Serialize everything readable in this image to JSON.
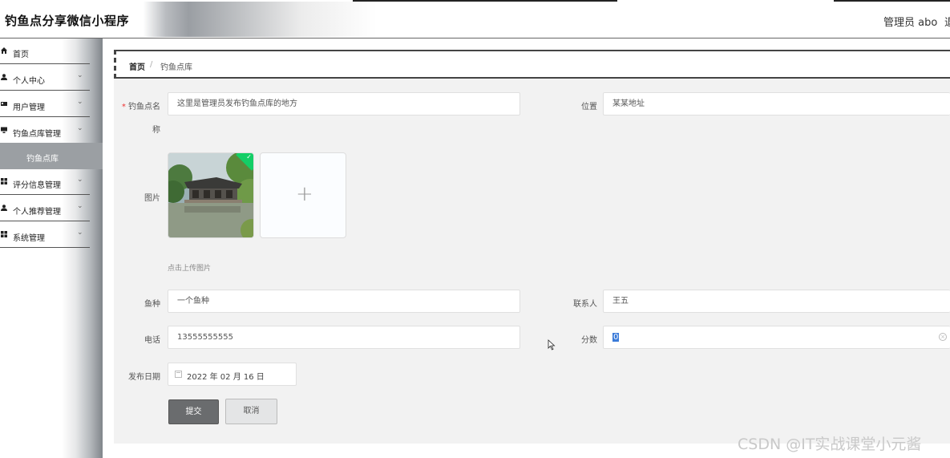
{
  "header": {
    "app_title": "钓鱼点分享微信小程序",
    "admin_label": "管理员 abo",
    "extra_text": "退"
  },
  "sidebar": {
    "items": [
      {
        "label": "首页",
        "icon": "home-icon"
      },
      {
        "label": "个人中心",
        "icon": "user-icon"
      },
      {
        "label": "用户管理",
        "icon": "user-card-icon"
      },
      {
        "label": "钓鱼点库管理",
        "icon": "monitor-icon"
      },
      {
        "label": "评分信息管理",
        "icon": "grid-icon"
      },
      {
        "label": "个人推荐管理",
        "icon": "user-icon"
      },
      {
        "label": "系统管理",
        "icon": "grid-icon"
      }
    ],
    "submenu_label": "钓鱼点库"
  },
  "breadcrumb": {
    "home": "首页",
    "separator": "/",
    "current": "钓鱼点库"
  },
  "form": {
    "name_label_part1": "钓鱼点名",
    "name_label_part2": "称",
    "name_value": "这里是管理员发布钓鱼点库的地方",
    "location_label": "位置",
    "location_value": "某某地址",
    "image_label": "图片",
    "upload_tip": "点击上传图片",
    "fish_label": "鱼种",
    "fish_value": "一个鱼种",
    "contact_label": "联系人",
    "contact_value": "王五",
    "phone_label": "电话",
    "phone_value": "13555555555",
    "score_label": "分数",
    "score_value": "0",
    "date_label": "发布日期",
    "date_value": "2022 年 02 月 16 日",
    "submit_label": "提交",
    "cancel_label": "取消"
  },
  "watermark": "CSDN @IT实战课堂小元酱",
  "colors": {
    "accent_green": "#13ce66",
    "submit_bg": "#6a6c6e",
    "selection_blue": "#3b7bd9"
  }
}
